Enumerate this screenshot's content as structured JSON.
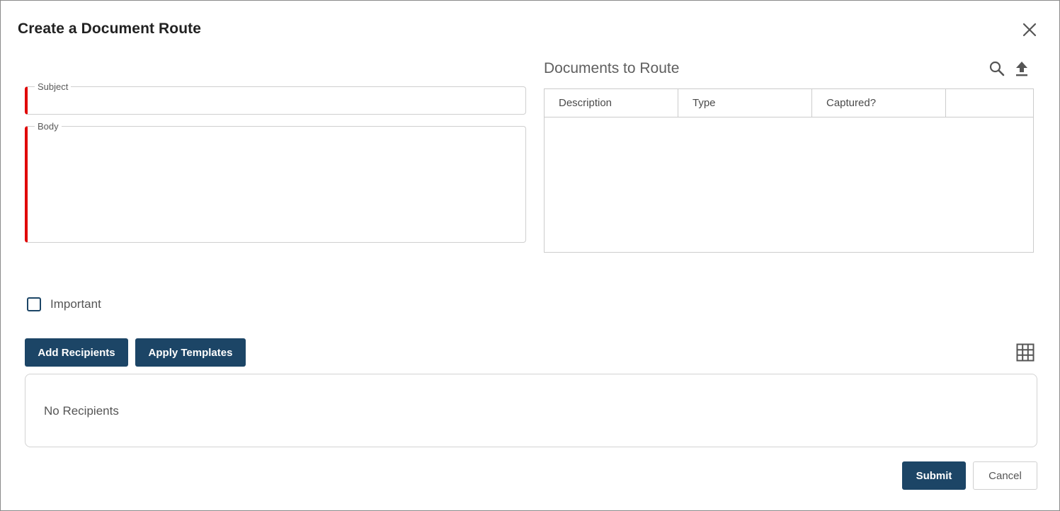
{
  "dialog": {
    "title": "Create a Document Route",
    "close_icon": "close-icon"
  },
  "form": {
    "subject": {
      "label": "Subject",
      "value": "",
      "required": true
    },
    "body": {
      "label": "Body",
      "value": "",
      "required": true
    }
  },
  "documents": {
    "title": "Documents to Route",
    "icons": [
      "search-icon",
      "upload-icon"
    ],
    "columns": [
      "Description",
      "Type",
      "Captured?",
      ""
    ],
    "rows": []
  },
  "important": {
    "label": "Important",
    "checked": false
  },
  "recipients": {
    "add_label": "Add Recipients",
    "templates_label": "Apply Templates",
    "grid_icon": "grid-icon",
    "empty_text": "No Recipients"
  },
  "actions": {
    "submit_label": "Submit",
    "cancel_label": "Cancel"
  },
  "colors": {
    "primary": "#1c4566",
    "required_marker": "#e00000",
    "border": "#cfcfcf"
  }
}
